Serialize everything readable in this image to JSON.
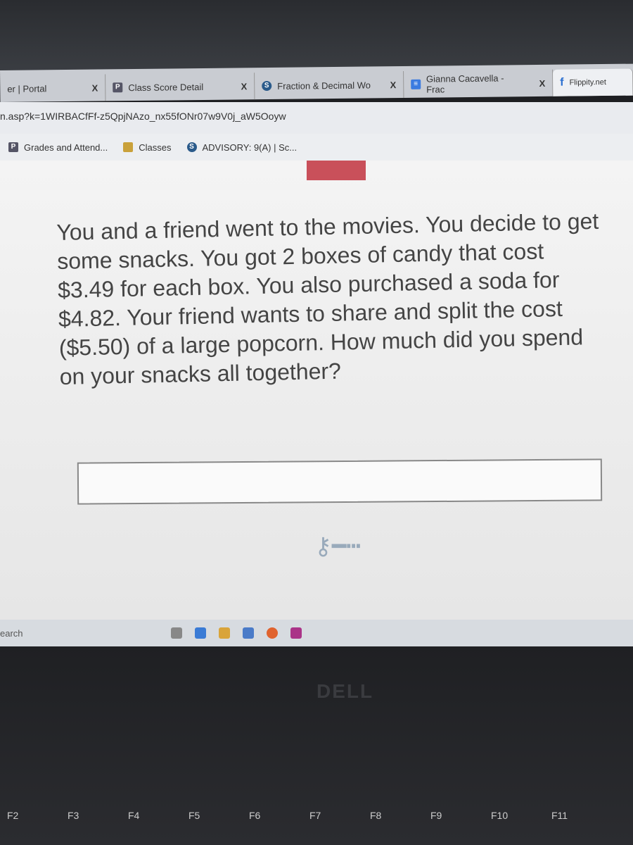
{
  "browser": {
    "tabs": [
      {
        "label": "er | Portal",
        "icon": "portal-icon",
        "close": "X"
      },
      {
        "label": "Class Score Detail",
        "icon": "powerschool-icon",
        "close": "X"
      },
      {
        "label": "Fraction & Decimal Wo",
        "icon": "schoology-icon",
        "close": "X"
      },
      {
        "label": "Gianna Cacavella - Frac",
        "icon": "google-docs-icon",
        "close": "X"
      },
      {
        "label": "Flippity.net",
        "icon": "flippity-icon",
        "active": true
      }
    ],
    "url": "n.asp?k=1WIRBACfFf-z5QpjNAzo_nx55fONr07w9V0j_aW5Ooyw",
    "bookmarks": [
      {
        "label": "Grades and Attend...",
        "icon": "powerschool-icon"
      },
      {
        "label": "Classes",
        "icon": "classroom-icon"
      },
      {
        "label": "ADVISORY: 9(A) | Sc...",
        "icon": "schoology-icon"
      }
    ]
  },
  "main": {
    "question": "You and a friend went to the movies. You decide to get some snacks. You got 2 boxes of candy that cost $3.49 for each box. You also purchased a soda for $4.82. Your friend wants to share and split the cost ($5.50) of a large popcorn. How much did you spend on your snacks all together?",
    "answer_value": "",
    "key_icon": "key-icon"
  },
  "taskbar": {
    "search_label": "earch"
  },
  "laptop": {
    "brand": "DELL",
    "fkeys": [
      "F2",
      "F3",
      "F4",
      "F5",
      "F6",
      "F7",
      "F8",
      "F9",
      "F10",
      "F11"
    ]
  }
}
